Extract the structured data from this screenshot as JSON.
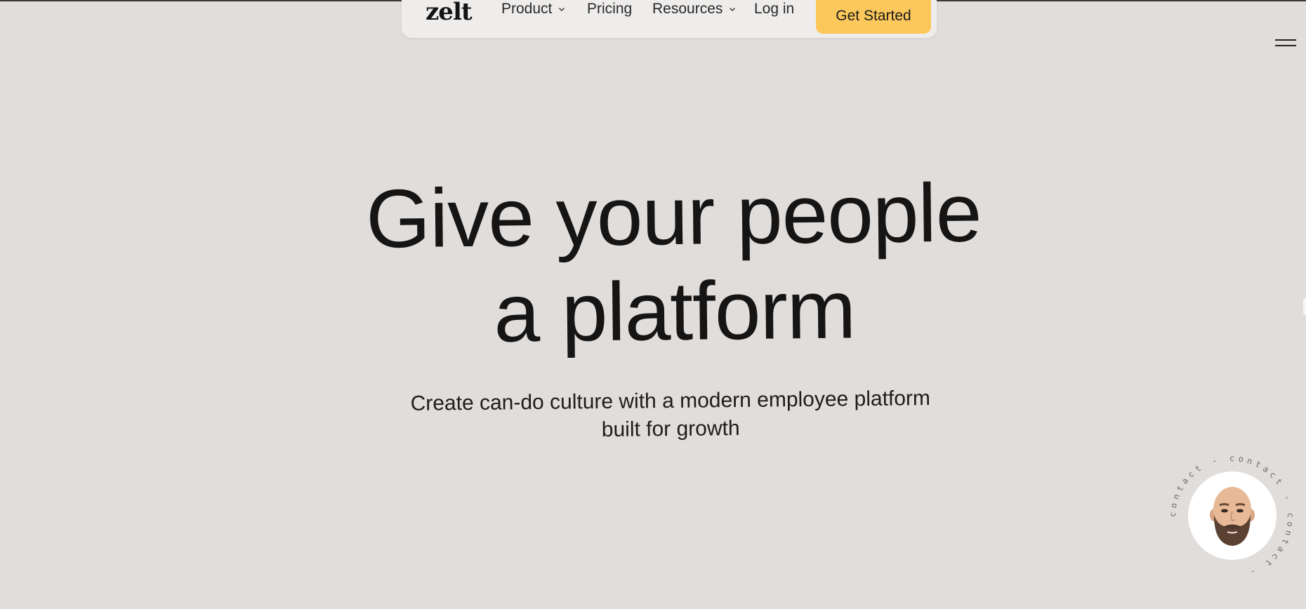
{
  "nav": {
    "logo": "zelt",
    "items": [
      {
        "label": "Product",
        "has_dropdown": true
      },
      {
        "label": "Pricing",
        "has_dropdown": false
      },
      {
        "label": "Resources",
        "has_dropdown": true
      },
      {
        "label": "Log in",
        "has_dropdown": false
      }
    ],
    "cta_label": "Get Started"
  },
  "hero": {
    "title_line1": "Give your people",
    "title_line2": "a platform",
    "subtitle_line1": "Create can-do culture with a modern employee platform",
    "subtitle_line2": "built for growth"
  },
  "contact_widget": {
    "ring_text": "contact - contact - contact -",
    "avatar_icon": "memoji-avatar-icon"
  },
  "colors": {
    "background": "#e1dddb",
    "nav_background": "#efedec",
    "cta": "#fcc85b",
    "text": "#151515"
  }
}
